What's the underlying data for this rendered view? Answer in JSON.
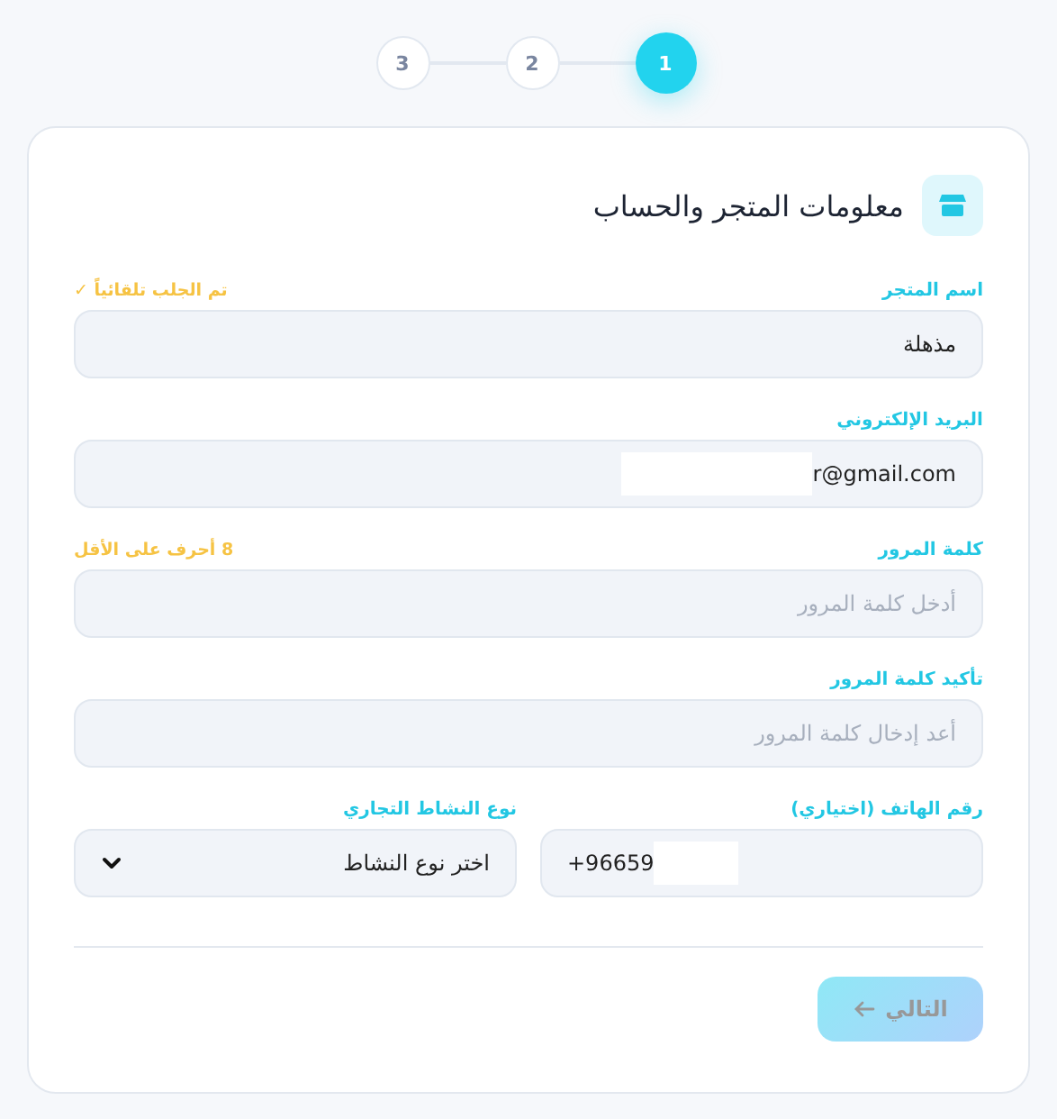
{
  "stepper": [
    {
      "label": "1",
      "selected": true
    },
    {
      "label": "2",
      "selected": false
    },
    {
      "label": "3",
      "selected": false
    }
  ],
  "card": {
    "title": "معلومات المتجر والحساب",
    "fields": [
      {
        "kind": "text",
        "label": "اسم المتجر",
        "hint": "تم الجلب تلقائياً ✓",
        "value": "مذهلة"
      },
      {
        "kind": "email",
        "label": "البريد الإلكتروني",
        "value": "r@gmail.com"
      },
      {
        "kind": "text",
        "label": "كلمة المرور",
        "hint": "8 أحرف على الأقل",
        "placeholder": "أدخل كلمة المرور"
      },
      {
        "kind": "text",
        "label": "تأكيد كلمة المرور",
        "placeholder": "أعد إدخال كلمة المرور"
      }
    ],
    "pair": [
      {
        "kind": "phone",
        "label": "رقم الهاتف (اختياري)",
        "value": "+96659"
      },
      {
        "kind": "select",
        "label": "نوع النشاط التجاري",
        "value": "اختر نوع النشاط"
      }
    ],
    "next_button": {
      "label": "التالي",
      "disabled": true
    }
  }
}
